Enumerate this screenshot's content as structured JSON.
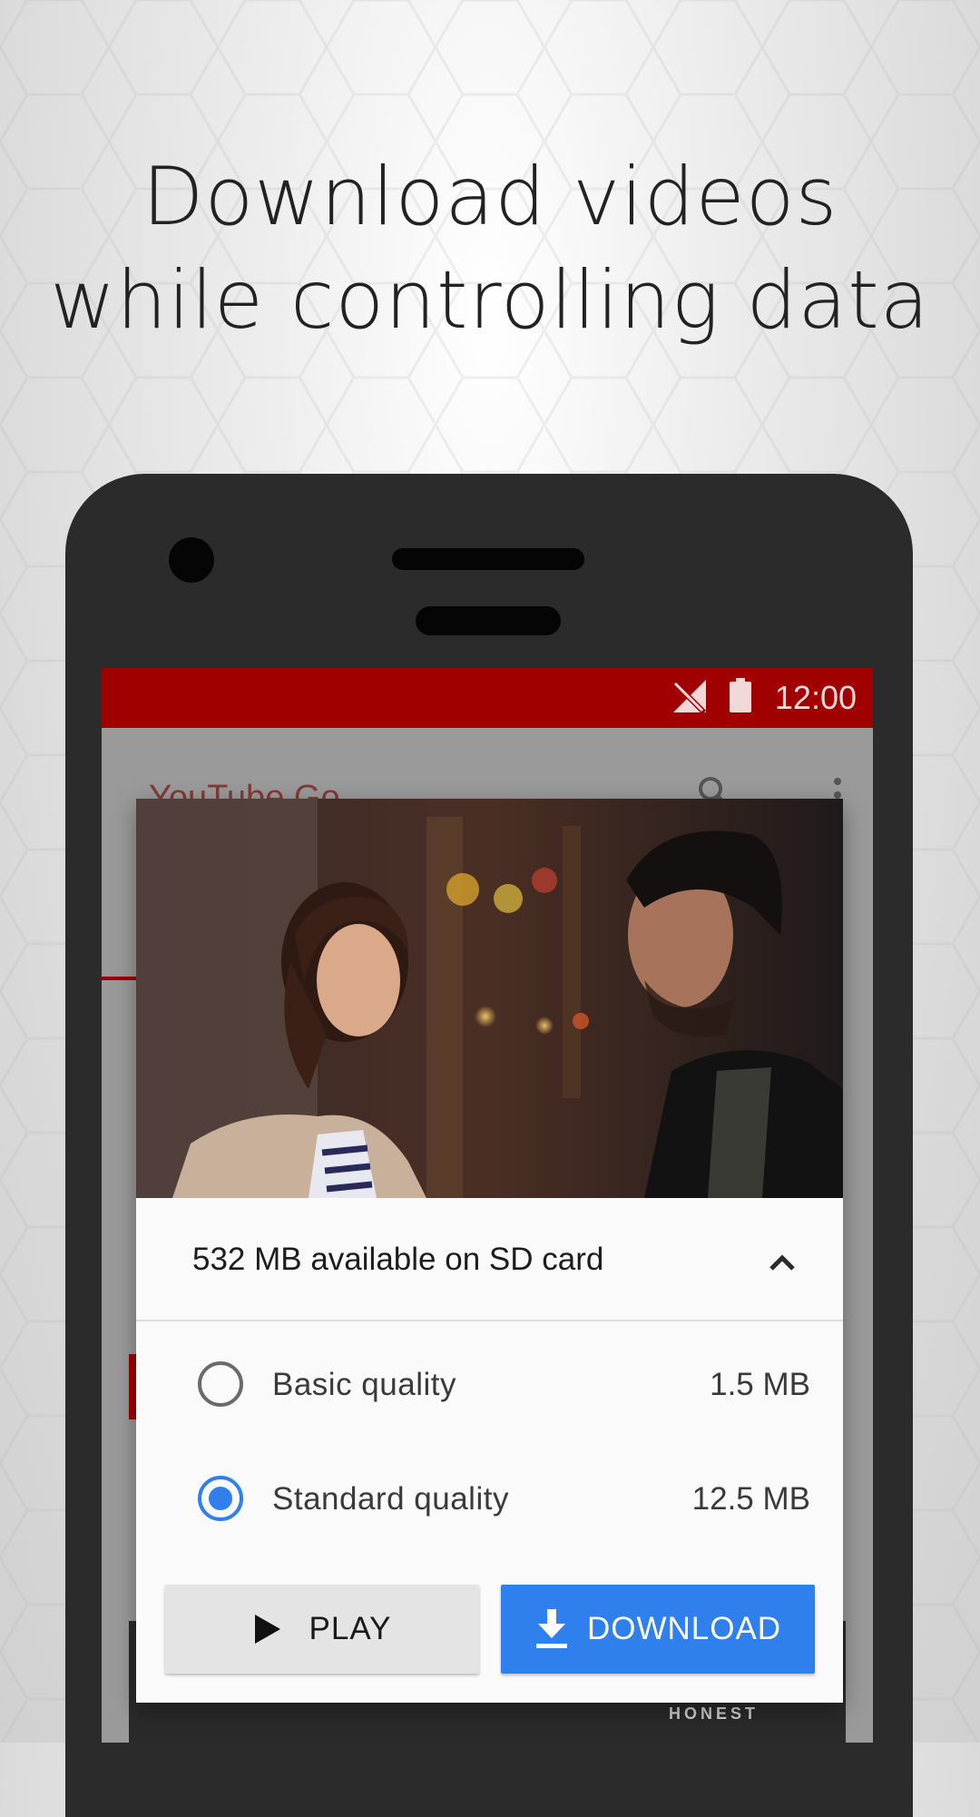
{
  "headline": {
    "line1": "Download videos",
    "line2": "while controlling data"
  },
  "status_bar": {
    "time": "12:00",
    "icons": [
      "signal-off-icon",
      "battery-icon"
    ],
    "color": "#a10000"
  },
  "app_background": {
    "title": "YouTube Go",
    "icons": [
      "search-icon",
      "more-vert-icon"
    ],
    "thumbnail_text": "HONEST"
  },
  "dialog": {
    "thumbnail": "video-thumbnail",
    "storage": {
      "text": "532 MB available on SD card",
      "icon": "chevron-up-icon"
    },
    "options": [
      {
        "label": "Basic quality",
        "size": "1.5 MB",
        "selected": false
      },
      {
        "label": "Standard quality",
        "size": "12.5 MB",
        "selected": true
      }
    ],
    "buttons": {
      "play": {
        "label": "PLAY",
        "icon": "play-icon"
      },
      "download": {
        "label": "DOWNLOAD",
        "icon": "download-icon"
      }
    }
  },
  "colors": {
    "accent_blue": "#2f80ed",
    "brand_red": "#a10000"
  }
}
